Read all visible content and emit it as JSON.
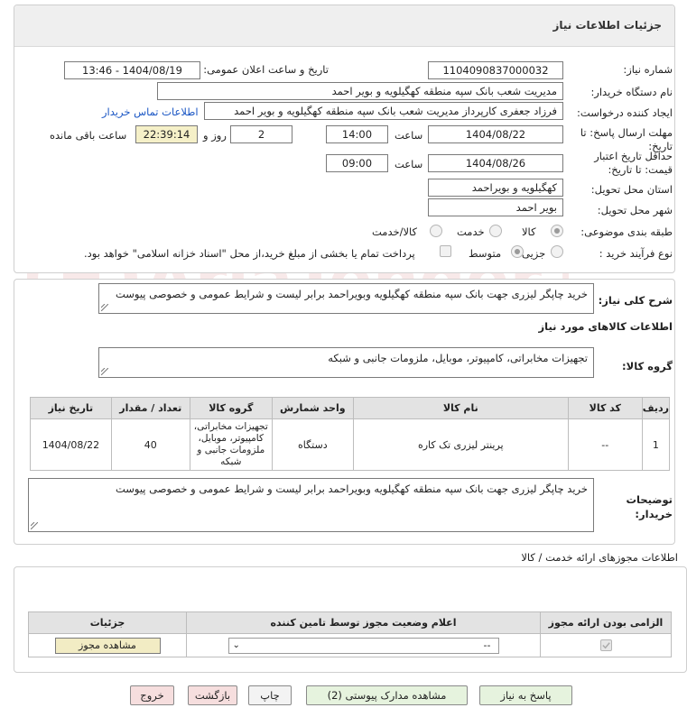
{
  "panel1": {
    "title": "جزئیات اطلاعات نیاز"
  },
  "fields": {
    "need_number_label": "شماره نیاز:",
    "need_number": "1104090837000032",
    "announce_label": "تاریخ و ساعت اعلان عمومی:",
    "announce_value": "1404/08/19 - 13:46",
    "buyer_org_label": "نام دستگاه خریدار:",
    "buyer_org": "مدیریت شعب بانک سپه منطقه کهگیلویه و بویر احمد",
    "requester_label": "ایجاد کننده درخواست:",
    "requester": "فرزاد جعفری کارپرداز مدیریت شعب بانک سپه منطقه کهگیلویه و بویر احمد",
    "contact_link": "اطلاعات تماس خریدار",
    "deadline_label": "مهلت ارسال پاسخ: تا تاریخ:",
    "deadline_date": "1404/08/22",
    "time_label": "ساعت",
    "deadline_time": "14:00",
    "days_value": "2",
    "days_label": "روز و",
    "remaining_time": "22:39:14",
    "remaining_label": "ساعت باقی مانده",
    "validity_label": "حداقل تاریخ اعتبار قیمت: تا تاریخ:",
    "validity_date": "1404/08/26",
    "validity_time": "09:00",
    "province_label": "استان محل تحویل:",
    "province": "کهگیلویه و بویراحمد",
    "city_label": "شهر محل تحویل:",
    "city": "بویر احمد",
    "category_label": "طبقه بندی موضوعی:",
    "category_options": [
      "کالا",
      "خدمت",
      "کالا/خدمت"
    ],
    "category_selected": "کالا",
    "process_label": "نوع فرآیند خرید :",
    "process_options": [
      "جزیی",
      "متوسط"
    ],
    "payment_note": "پرداخت تمام یا بخشی از مبلغ خرید،از محل \"اسناد خزانه اسلامی\" خواهد بود."
  },
  "summary": {
    "label": "شرح کلی نیاز:",
    "text": "خرید چاپگر لیزری جهت بانک سپه منطقه کهگیلویه وبویراحمد  برابر لیست و شرایط عمومی و خصوصی پیوست"
  },
  "goods_info": {
    "title": "اطلاعات کالاهای مورد نیاز",
    "group_label": "گروه کالا:",
    "group_value": "تجهیزات مخابراتی، کامپیوتر، موبایل، ملزومات جانبی و شبکه"
  },
  "items_table": {
    "headers": [
      "ردیف",
      "کد کالا",
      "نام کالا",
      "واحد شمارش",
      "گروه کالا",
      "تعداد / مقدار",
      "تاریخ نیاز"
    ],
    "rows": [
      {
        "index": "1",
        "code": "--",
        "name": "پرینتر لیزری تک کاره",
        "unit": "دستگاه",
        "group": "تجهیزات مخابراتی، کامپیوتر، موبایل، ملزومات جانبی و شبکه",
        "qty": "40",
        "date": "1404/08/22"
      }
    ]
  },
  "buyer_notes": {
    "label": "توضیحات خریدار:",
    "text": "خرید چاپگر لیزری  جهت بانک سپه منطقه کهگیلویه وبویراحمد  برابر لیست و شرایط عمومی و خصوصی پیوست"
  },
  "permits": {
    "title": "اطلاعات مجوزهای ارائه خدمت / کالا",
    "headers": [
      "الزامی بودن ارائه مجوز",
      "اعلام وضعیت مجوز توسط تامین کننده",
      "جزئیات"
    ],
    "select_value": "--",
    "view_button": "مشاهده مجوز"
  },
  "actions": {
    "reply": "پاسخ به نیاز",
    "docs": "مشاهده مدارک پیوستی (2)",
    "print": "چاپ",
    "back": "بازگشت",
    "exit": "خروج"
  },
  "watermark": "AriaTender.neT",
  "colors": {
    "link": "#1a56c4",
    "yellow_field": "#f5f0c8",
    "header_bg": "#efefef",
    "green_btn": "#e6f3de",
    "pink_btn": "#f6dede"
  }
}
